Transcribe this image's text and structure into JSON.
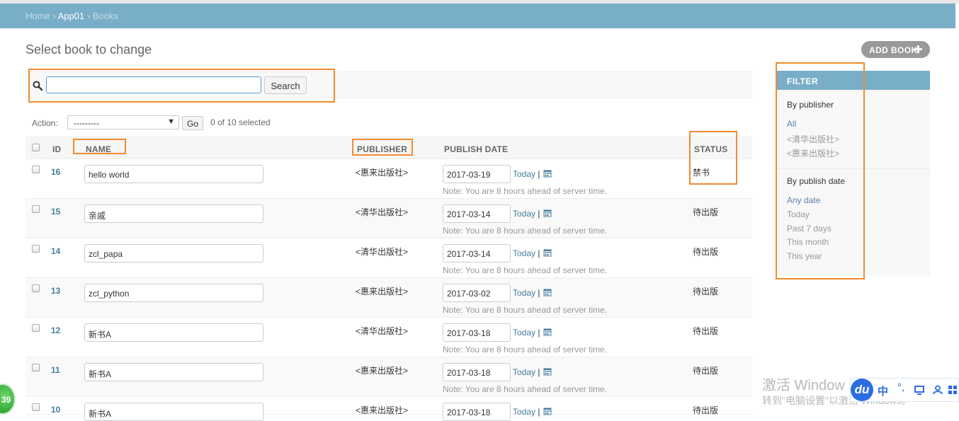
{
  "breadcrumbs": {
    "home": "Home",
    "sep1": "›",
    "app": "App01",
    "sep2": "›",
    "current": "Books"
  },
  "page_title": "Select book to change",
  "add_button": "ADD BOOK",
  "search": {
    "value": "",
    "button": "Search"
  },
  "actions": {
    "label": "Action:",
    "selected": "---------",
    "go": "Go",
    "counter": "0 of 10 selected"
  },
  "columns": {
    "id": "ID",
    "name": "NAME",
    "publisher": "PUBLISHER",
    "publish_date": "PUBLISH DATE",
    "status": "STATUS"
  },
  "rows": [
    {
      "id": "16",
      "name": "hello world",
      "publisher": "<惠来出版社>",
      "date": "2017-03-19",
      "today": "Today",
      "sep": "|",
      "note": "Note: You are 8 hours ahead of server time.",
      "status": "禁书"
    },
    {
      "id": "15",
      "name": "亲戚",
      "publisher": "<清华出版社>",
      "date": "2017-03-14",
      "today": "Today",
      "sep": "|",
      "note": "Note: You are 8 hours ahead of server time.",
      "status": "待出版"
    },
    {
      "id": "14",
      "name": "zcl_papa",
      "publisher": "<清华出版社>",
      "date": "2017-03-14",
      "today": "Today",
      "sep": "|",
      "note": "Note: You are 8 hours ahead of server time.",
      "status": "待出版"
    },
    {
      "id": "13",
      "name": "zcl_python",
      "publisher": "<惠来出版社>",
      "date": "2017-03-02",
      "today": "Today",
      "sep": "|",
      "note": "Note: You are 8 hours ahead of server time.",
      "status": "待出版"
    },
    {
      "id": "12",
      "name": "新书A",
      "publisher": "<清华出版社>",
      "date": "2017-03-18",
      "today": "Today",
      "sep": "|",
      "note": "Note: You are 8 hours ahead of server time.",
      "status": "待出版"
    },
    {
      "id": "11",
      "name": "新书A",
      "publisher": "<惠来出版社>",
      "date": "2017-03-18",
      "today": "Today",
      "sep": "|",
      "note": "Note: You are 8 hours ahead of server time.",
      "status": "待出版"
    },
    {
      "id": "10",
      "name": "新书A",
      "publisher": "<惠来出版社>",
      "date": "2017-03-18",
      "today": "Today",
      "sep": "|",
      "note": "",
      "status": "待出版"
    }
  ],
  "filter": {
    "title": "FILTER",
    "by_publisher": {
      "title": "By publisher",
      "items": [
        "All",
        "<清华出版社>",
        "<惠来出版社>"
      ]
    },
    "by_date": {
      "title": "By publish date",
      "items": [
        "Any date",
        "Today",
        "Past 7 days",
        "This month",
        "This year"
      ]
    }
  },
  "overlay": {
    "watermark_line1": "激活 Window",
    "watermark_line2": "转到\"电脑设置\"以激活 Windows。",
    "ime_logo": "du",
    "ime_mode": "中",
    "ime_punct": "°,",
    "badge": "39"
  },
  "colors": {
    "header": "#79aec8",
    "link": "#447e9b",
    "highlight": "#f28b30",
    "add_button": "#999999"
  }
}
